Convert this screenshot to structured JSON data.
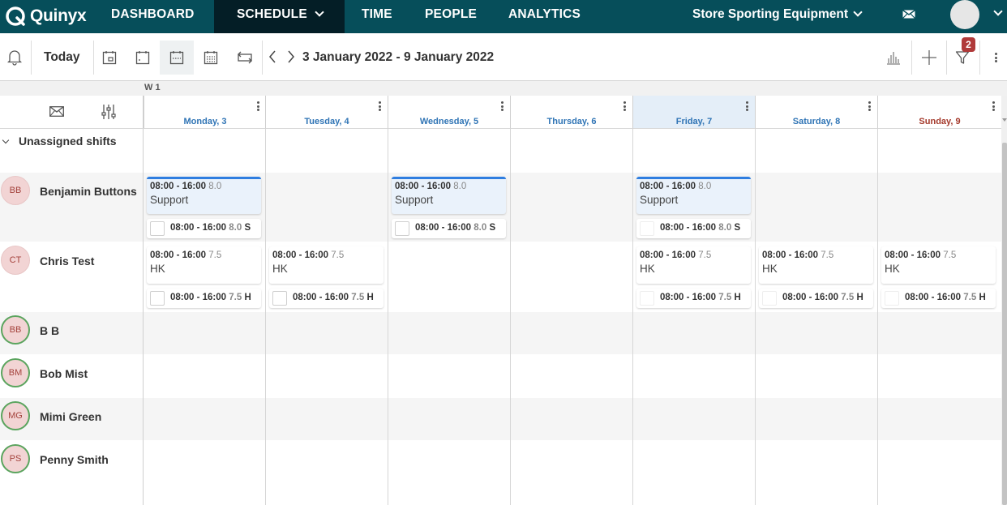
{
  "nav": {
    "brand": "Quinyx",
    "items": [
      {
        "label": "DASHBOARD",
        "active": false
      },
      {
        "label": "SCHEDULE",
        "active": true
      },
      {
        "label": "TIME",
        "active": false
      },
      {
        "label": "PEOPLE",
        "active": false
      },
      {
        "label": "ANALYTICS",
        "active": false
      }
    ],
    "store": "Store Sporting Equipment"
  },
  "toolbar": {
    "today_label": "Today",
    "date_range": "3 January 2022 - 9 January 2022",
    "filter_count": "2"
  },
  "grid": {
    "week_label": "W 1",
    "days": [
      {
        "label": "Monday, 3"
      },
      {
        "label": "Tuesday, 4"
      },
      {
        "label": "Wednesday, 5"
      },
      {
        "label": "Thursday, 6"
      },
      {
        "label": "Friday, 7",
        "today": true
      },
      {
        "label": "Saturday, 8"
      },
      {
        "label": "Sunday, 9",
        "sunday": true
      }
    ],
    "unassigned_label": "Unassigned shifts"
  },
  "employees": [
    {
      "initials": "BB",
      "name": "Benjamin Buttons"
    },
    {
      "initials": "CT",
      "name": "Chris Test"
    },
    {
      "initials": "BB",
      "name": "B B"
    },
    {
      "initials": "BM",
      "name": "Bob Mist"
    },
    {
      "initials": "MG",
      "name": "Mimi Green"
    },
    {
      "initials": "PS",
      "name": "Penny Smith"
    }
  ],
  "shifts": {
    "support": {
      "time": "08:00 - 16:00",
      "hours": "8.0",
      "task": "Support",
      "sub_time": "08:00 - 16:00",
      "sub_hours": "8.0",
      "sub_tag": "S"
    },
    "hk": {
      "time": "08:00 - 16:00",
      "hours": "7.5",
      "task": "HK",
      "sub_time": "08:00 - 16:00",
      "sub_hours": "7.5",
      "sub_tag": "H"
    }
  },
  "colors": {
    "nav_bg": "#064e5a",
    "nav_active": "#041e26",
    "day_text": "#2f74b5",
    "sunday_text": "#a4392b",
    "support_accent": "#2f7ee0",
    "badge": "#b03a3a",
    "avatar_ring": "#5ba45e"
  }
}
